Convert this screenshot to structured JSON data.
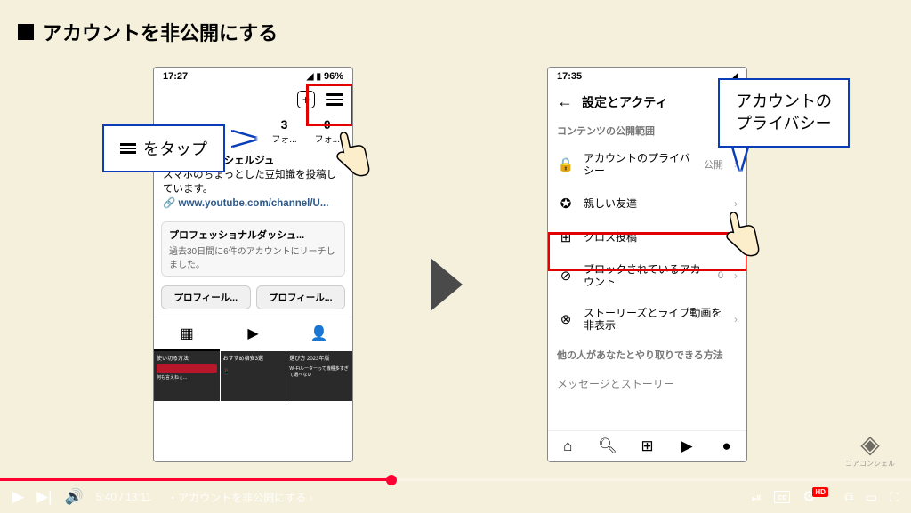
{
  "slide": {
    "title": "アカウントを非公開にする"
  },
  "callout1": {
    "text": "をタップ"
  },
  "callout2": {
    "line1": "アカウントの",
    "line2": "プライバシー"
  },
  "phone_left": {
    "time": "17:27",
    "battery": "96%",
    "stat1_num": "3",
    "stat1_label": "フォ...",
    "stat2_num": "0",
    "stat2_label": "フォ...",
    "bio_title": "スマホのコンシェルジュ",
    "bio_desc": "スマホのちょっとした豆知識を投稿しています。",
    "bio_link": "www.youtube.com/channel/U...",
    "dash_title": "プロフェッショナルダッシュ...",
    "dash_sub": "過去30日間に6件のアカウントにリーチしました。",
    "btn1": "プロフィール...",
    "btn2": "プロフィール...",
    "thumb1": "使い切る方法",
    "thumb2": "おすすめ格安3選",
    "thumb3": "選び方 2023年版"
  },
  "phone_right": {
    "time": "17:35",
    "header": "設定とアクティ",
    "section": "コンテンツの公開範囲",
    "row1": "アカウントのプライバシー",
    "row1_right": "公開",
    "row2": "親しい友達",
    "row3": "クロス投稿",
    "row4": "ブロックされているアカウント",
    "row4_right": "0",
    "row5": "ストーリーズとライブ動画を非表示",
    "footer": "他の人があなたとやり取りできる方法",
    "row6": "メッセージとストーリー"
  },
  "watermark": {
    "text": "コアコンシェル"
  },
  "yt": {
    "time_current": "5:40",
    "time_total": "13:11",
    "chapter": "・アカウントを非公開にする",
    "hd": "HD"
  }
}
